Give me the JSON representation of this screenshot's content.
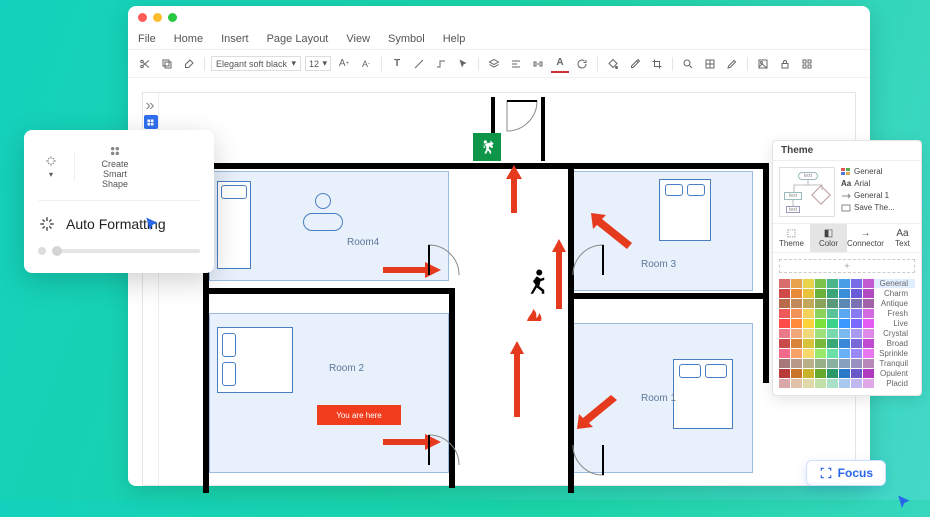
{
  "window": {
    "traffic": [
      "#fc5b57",
      "#fdbb2e",
      "#28c840"
    ]
  },
  "menu": [
    "File",
    "Home",
    "Insert",
    "Page Layout",
    "View",
    "Symbol",
    "Help"
  ],
  "toolbar": {
    "font": "Elegant soft black",
    "size": "12"
  },
  "popup": {
    "smart_button": "Create Smart Shape",
    "title": "Auto Formatting"
  },
  "canvas": {
    "rooms": [
      {
        "id": "room4",
        "label": "Room4"
      },
      {
        "id": "room3",
        "label": "Room 3"
      },
      {
        "id": "room2",
        "label": "Room 2"
      },
      {
        "id": "room1",
        "label": "Room 1"
      }
    ],
    "you_are_here": "You are here"
  },
  "theme": {
    "title": "Theme",
    "list": [
      "General",
      "Arial",
      "General 1",
      "Save The..."
    ],
    "tabs": [
      "Theme",
      "Color",
      "Connector",
      "Text"
    ],
    "active_tab": 1,
    "palettes": [
      "General",
      "Charm",
      "Antique",
      "Fresh",
      "Live",
      "Crystal",
      "Broad",
      "Sprinkle",
      "Tranquil",
      "Opulent",
      "Placid"
    ],
    "active_palette": 0,
    "colors": {
      "General": [
        "#d96c6c",
        "#e8a24a",
        "#e8d34a",
        "#7cc24a",
        "#4ab58a",
        "#4a9ee8",
        "#7a6ce8",
        "#c25ad1"
      ],
      "Charm": [
        "#d14a4a",
        "#e88a3a",
        "#e8c23a",
        "#6cb23a",
        "#3aa57a",
        "#3a8ed8",
        "#6a5cd8",
        "#b24ac1"
      ],
      "Antique": [
        "#b86a4a",
        "#c28a5a",
        "#c2a85a",
        "#8aa25a",
        "#5a9a7a",
        "#5a88b2",
        "#7a72b2",
        "#a262a8"
      ],
      "Fresh": [
        "#ee5a5a",
        "#f2945a",
        "#f2d25a",
        "#8ad25a",
        "#5ac29a",
        "#5aa8f2",
        "#8a7af2",
        "#d26ae0"
      ],
      "Live": [
        "#ff4a4a",
        "#ff8a3a",
        "#ffd23a",
        "#7ae23a",
        "#3ad28a",
        "#3a98ff",
        "#7a6aff",
        "#e25af0"
      ],
      "Crystal": [
        "#e87a8a",
        "#f0a87a",
        "#f0d87a",
        "#a0e07a",
        "#7ad8b0",
        "#7ab8f0",
        "#a89af0",
        "#e08ae8"
      ],
      "Broad": [
        "#c84a4a",
        "#d8843a",
        "#d8c23a",
        "#78b83a",
        "#3aa878",
        "#3a88d8",
        "#7868d8",
        "#c04ad0"
      ],
      "Sprinkle": [
        "#f26a8a",
        "#f8a26a",
        "#f8d86a",
        "#98e86a",
        "#6ae0a8",
        "#6ab0f8",
        "#9888f8",
        "#e878f0"
      ],
      "Tranquil": [
        "#a87878",
        "#b89888",
        "#b8b088",
        "#98b088",
        "#88b0a0",
        "#88a0c0",
        "#9890c0",
        "#b888b8"
      ],
      "Opulent": [
        "#b83a3a",
        "#c8742a",
        "#c8b22a",
        "#68a82a",
        "#2a9868",
        "#2a78c8",
        "#6858c8",
        "#b03ac0"
      ],
      "Placid": [
        "#d8a8a8",
        "#e0c0a8",
        "#e0d8a8",
        "#c0e0a8",
        "#a8e0c8",
        "#a8c8f0",
        "#c0b8f0",
        "#e0a8e8"
      ]
    }
  },
  "focus": "Focus"
}
